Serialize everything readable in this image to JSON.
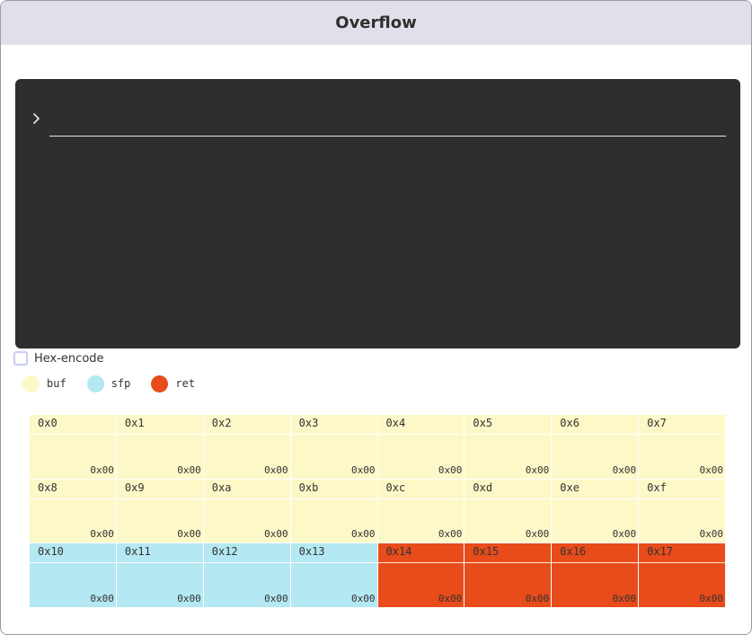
{
  "window": {
    "title": "Overflow"
  },
  "terminal": {
    "prompt_icon": "chevron-right-icon",
    "input_value": ""
  },
  "hex_encode": {
    "label": "Hex-encode",
    "checked": false
  },
  "legend": [
    {
      "label": "buf",
      "color": "#fdf8c8"
    },
    {
      "label": "sfp",
      "color": "#b4e8f2"
    },
    {
      "label": "ret",
      "color": "#e74c1a"
    }
  ],
  "colors": {
    "buf": "#fdf8c8",
    "sfp": "#b4e8f2",
    "ret": "#e74c1a",
    "terminal_bg": "#2e2e2e",
    "titlebar_bg": "#e0e0ea"
  },
  "memory": [
    {
      "addr": "0x0",
      "value": "0x00",
      "region": "buf"
    },
    {
      "addr": "0x1",
      "value": "0x00",
      "region": "buf"
    },
    {
      "addr": "0x2",
      "value": "0x00",
      "region": "buf"
    },
    {
      "addr": "0x3",
      "value": "0x00",
      "region": "buf"
    },
    {
      "addr": "0x4",
      "value": "0x00",
      "region": "buf"
    },
    {
      "addr": "0x5",
      "value": "0x00",
      "region": "buf"
    },
    {
      "addr": "0x6",
      "value": "0x00",
      "region": "buf"
    },
    {
      "addr": "0x7",
      "value": "0x00",
      "region": "buf"
    },
    {
      "addr": "0x8",
      "value": "0x00",
      "region": "buf"
    },
    {
      "addr": "0x9",
      "value": "0x00",
      "region": "buf"
    },
    {
      "addr": "0xa",
      "value": "0x00",
      "region": "buf"
    },
    {
      "addr": "0xb",
      "value": "0x00",
      "region": "buf"
    },
    {
      "addr": "0xc",
      "value": "0x00",
      "region": "buf"
    },
    {
      "addr": "0xd",
      "value": "0x00",
      "region": "buf"
    },
    {
      "addr": "0xe",
      "value": "0x00",
      "region": "buf"
    },
    {
      "addr": "0xf",
      "value": "0x00",
      "region": "buf"
    },
    {
      "addr": "0x10",
      "value": "0x00",
      "region": "sfp"
    },
    {
      "addr": "0x11",
      "value": "0x00",
      "region": "sfp"
    },
    {
      "addr": "0x12",
      "value": "0x00",
      "region": "sfp"
    },
    {
      "addr": "0x13",
      "value": "0x00",
      "region": "sfp"
    },
    {
      "addr": "0x14",
      "value": "0x00",
      "region": "ret"
    },
    {
      "addr": "0x15",
      "value": "0x00",
      "region": "ret"
    },
    {
      "addr": "0x16",
      "value": "0x00",
      "region": "ret"
    },
    {
      "addr": "0x17",
      "value": "0x00",
      "region": "ret"
    }
  ]
}
